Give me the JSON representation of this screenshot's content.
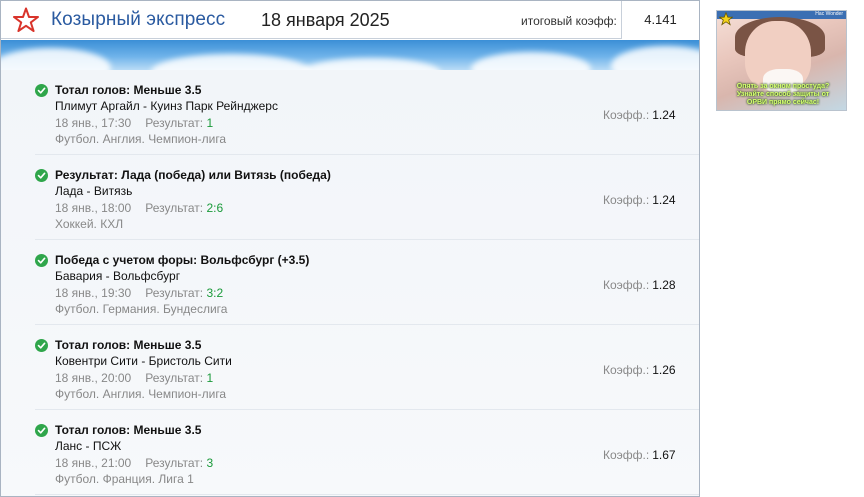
{
  "header": {
    "title": "Козырный экспресс",
    "date": "18 января 2025",
    "total_label": "итоговый коэфф:",
    "total_value": "4.141"
  },
  "bets": [
    {
      "title": "Тотал голов: Меньше 3.5",
      "match": "Плимут Аргайл - Куинз Парк Рейнджерс",
      "time": "18 янв., 17:30",
      "result_label": "Результат:",
      "result": "1",
      "league": "Футбол. Англия. Чемпион-лига",
      "coef_label": "Коэфф.:",
      "coef": "1.24"
    },
    {
      "title": "Результат: Лада (победа) или Витязь (победа)",
      "match": "Лада - Витязь",
      "time": "18 янв., 18:00",
      "result_label": "Результат:",
      "result": "2:6",
      "league": "Хоккей. КХЛ",
      "coef_label": "Коэфф.:",
      "coef": "1.24"
    },
    {
      "title": "Победа с учетом форы: Вольфсбург (+3.5)",
      "match": "Бавария - Вольфсбург",
      "time": "18 янв., 19:30",
      "result_label": "Результат:",
      "result": "3:2",
      "league": "Футбол. Германия. Бундеслига",
      "coef_label": "Коэфф.:",
      "coef": "1.28"
    },
    {
      "title": "Тотал голов: Меньше 3.5",
      "match": "Ковентри Сити - Бристоль Сити",
      "time": "18 янв., 20:00",
      "result_label": "Результат:",
      "result": "1",
      "league": "Футбол. Англия. Чемпион-лига",
      "coef_label": "Коэфф.:",
      "coef": "1.26"
    },
    {
      "title": "Тотал голов: Меньше 3.5",
      "match": "Ланс - ПСЖ",
      "time": "18 янв., 21:00",
      "result_label": "Результат:",
      "result": "3",
      "league": "Футбол. Франция. Лига 1",
      "coef_label": "Коэфф.:",
      "coef": "1.67"
    }
  ],
  "ad": {
    "top_text": "Нас Wonder",
    "caption": "Опять за окном простуда? Узнайте способ защиты от ОРВИ прямо сейчас!",
    "icons": {
      "badge": "star-badge-icon"
    }
  },
  "colors": {
    "brand_blue": "#2a5aa0",
    "status_green": "#2fa64b",
    "result_green": "#1a9a3a",
    "star_red": "#d9342b"
  }
}
